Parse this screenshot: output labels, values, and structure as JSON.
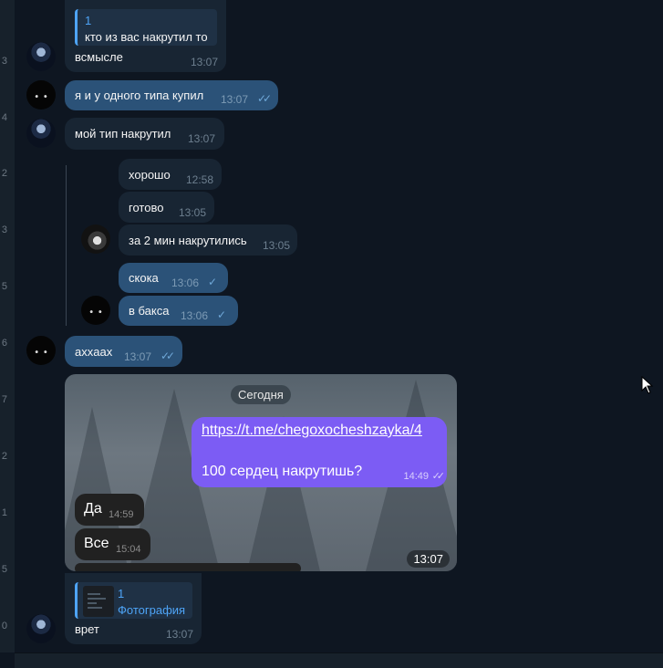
{
  "gutter_numbers": [
    "3",
    "4",
    "2",
    "3",
    "5",
    "6",
    "7",
    "2",
    "1",
    "5",
    "0"
  ],
  "messages": {
    "m1": {
      "quote_name": "1",
      "quote_text": "кто из вас накрутил то",
      "text": "всмысле",
      "time": "13:07"
    },
    "m2": {
      "text": "я и у одного типа купил",
      "time": "13:07",
      "checks": "✓✓"
    },
    "m3": {
      "text": "мой тип накрутил",
      "time": "13:07"
    },
    "m4": {
      "text": "хорошо",
      "time": "12:58"
    },
    "m5": {
      "text": "готово",
      "time": "13:05"
    },
    "m6": {
      "text": "за 2 мин накрутились",
      "time": "13:05"
    },
    "m7": {
      "text": "скока",
      "time": "13:06",
      "checks": "✓"
    },
    "m8": {
      "text": "в бакса",
      "time": "13:06",
      "checks": "✓"
    },
    "m9": {
      "text": "ахxаах",
      "time": "13:07",
      "checks": "✓✓"
    },
    "m10": {
      "quote_name": "1",
      "quote_text": "Фотография",
      "text": "врет",
      "time": "13:07"
    }
  },
  "screenshot": {
    "date_label": "Сегодня",
    "link": "https://t.me/chegoxocheshzayka/4",
    "outgoing_text": "100 сердец накрутишь?",
    "outgoing_time": "14:49",
    "outgoing_checks": "✓✓",
    "reply1": {
      "text": "Да",
      "time": "14:59"
    },
    "reply2": {
      "text": "Все",
      "time": "15:04"
    },
    "time": "13:07"
  }
}
